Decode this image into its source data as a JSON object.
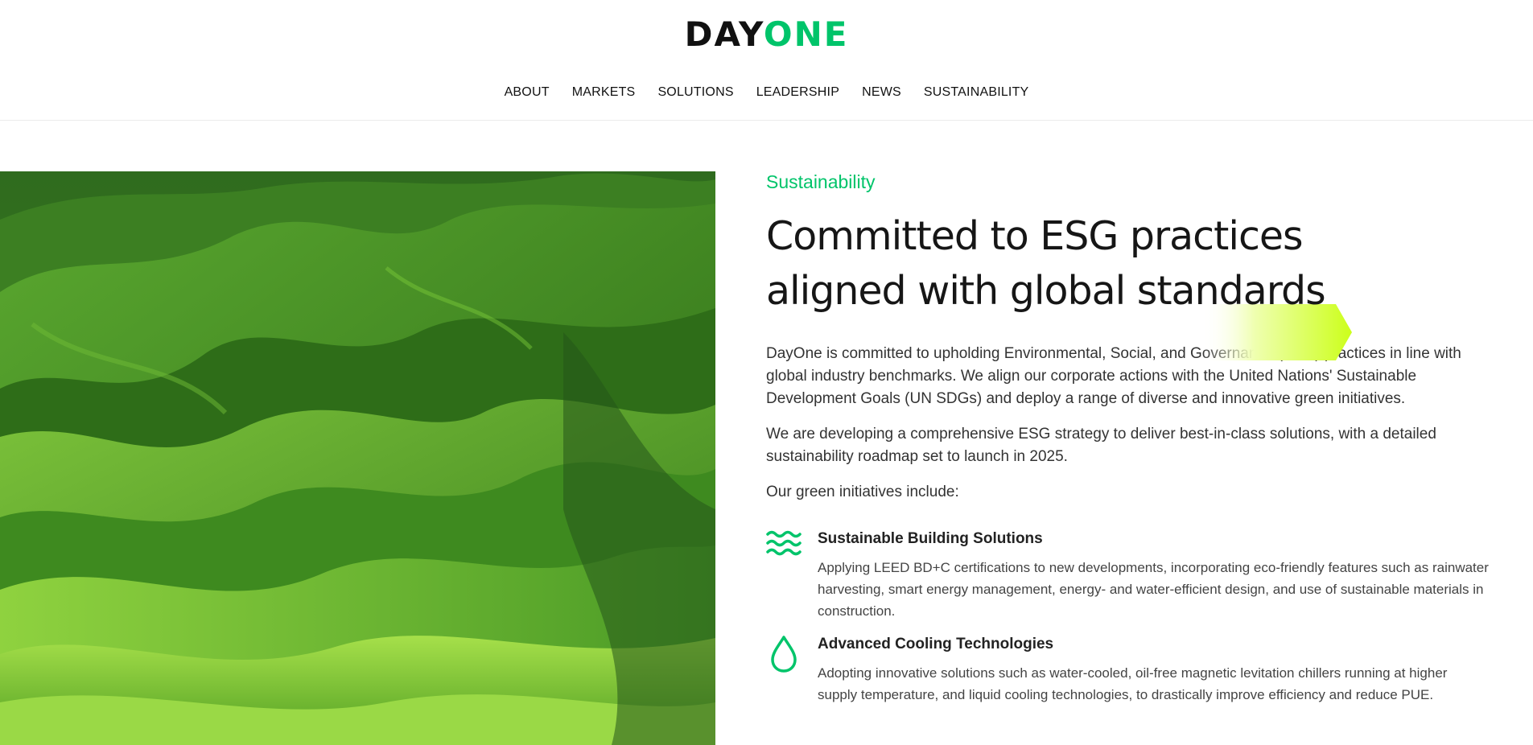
{
  "brand": {
    "logo_part1": "DAY",
    "logo_part2": "ONE",
    "accent": "#00c46a",
    "highlight": "#d4ff2a"
  },
  "nav": {
    "items": [
      "ABOUT",
      "MARKETS",
      "SOLUTIONS",
      "LEADERSHIP",
      "NEWS",
      "SUSTAINABILITY"
    ]
  },
  "hero": {
    "image": "green-rolling-hills"
  },
  "content": {
    "eyebrow": "Sustainability",
    "headline_line1": "Committed to ESG practices",
    "headline_line2_prefix": "aligned with global ",
    "headline_line2_highlight": "standards",
    "paragraph1": "DayOne is committed to upholding Environmental, Social, and Governance (ESG) practices in line with global industry benchmarks. We align our corporate actions with the United Nations' Sustainable Development Goals (UN SDGs) and deploy a range of diverse and innovative green initiatives.",
    "paragraph2": "We are developing a comprehensive ESG strategy to deliver best-in-class solutions, with a detailed sustainability roadmap set to launch in 2025.",
    "paragraph3": "Our green initiatives include:",
    "features": [
      {
        "icon": "waves-icon",
        "title": "Sustainable Building Solutions",
        "text": "Applying LEED BD+C certifications to new developments, incorporating eco-friendly features such as rainwater harvesting, smart energy management, energy- and water-efficient design, and use of sustainable materials in construction."
      },
      {
        "icon": "water-drop-icon",
        "title": "Advanced Cooling Technologies",
        "text": "Adopting innovative solutions such as water-cooled, oil-free magnetic levitation chillers running at higher supply temperature, and liquid cooling technologies, to drastically improve efficiency and reduce PUE."
      }
    ]
  }
}
